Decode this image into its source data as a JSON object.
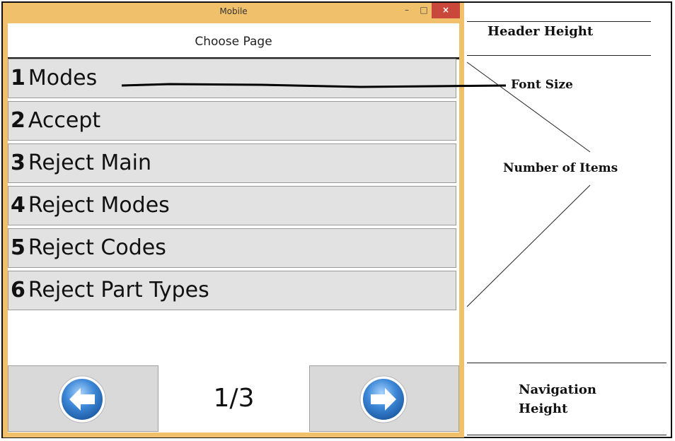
{
  "window": {
    "title": "Mobile",
    "minimize_glyph": "–",
    "maximize_glyph": "□",
    "close_glyph": "×"
  },
  "header": {
    "title": "Choose Page"
  },
  "items": [
    {
      "number": "1",
      "label": "Modes"
    },
    {
      "number": "2",
      "label": "Accept"
    },
    {
      "number": "3",
      "label": "Reject Main"
    },
    {
      "number": "4",
      "label": "Reject Modes"
    },
    {
      "number": "5",
      "label": "Reject Codes"
    },
    {
      "number": "6",
      "label": "Reject Part Types"
    }
  ],
  "navigation": {
    "page_indicator": "1/3",
    "prev_icon": "arrow-left-icon",
    "next_icon": "arrow-right-icon"
  },
  "annotations": {
    "header_height": "Header Height",
    "font_size": "Font Size",
    "number_of_items": "Number of Items",
    "navigation_height_line1": "Navigation",
    "navigation_height_line2": "Height"
  },
  "colors": {
    "window_frame": "#f0c16a",
    "close_button": "#c9483b",
    "item_background": "#e2e2e2",
    "nav_arrow_blue": "#3b86d6"
  }
}
